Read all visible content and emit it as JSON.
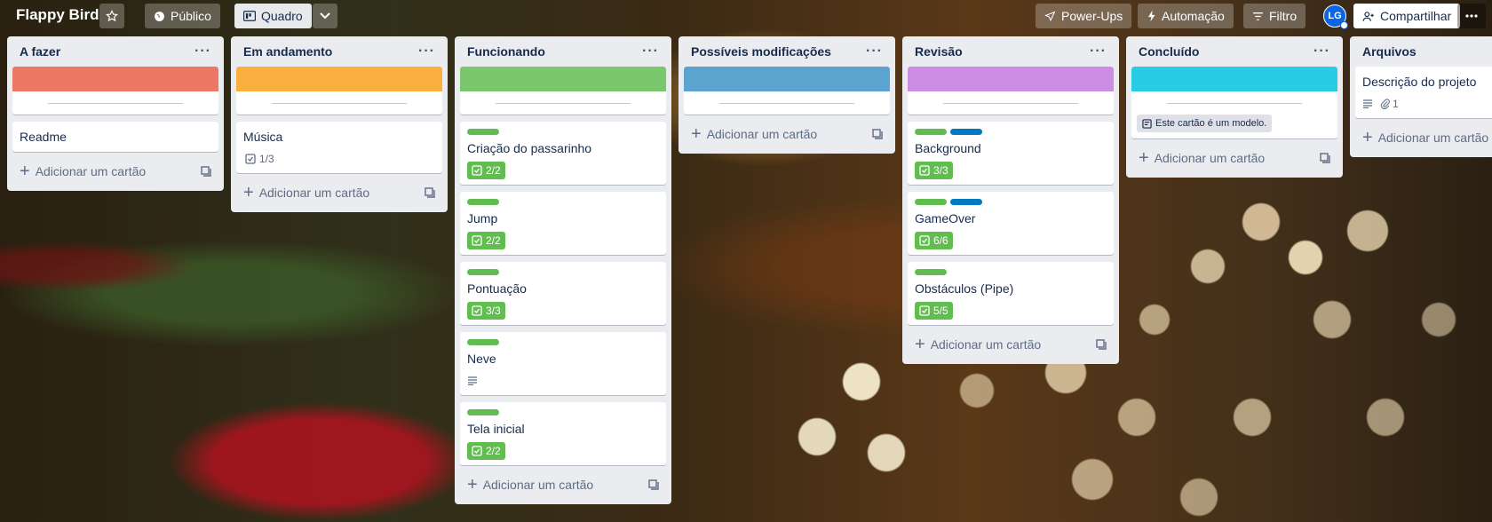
{
  "board": {
    "title": "Flappy Bird",
    "visibility": "Público",
    "view": "Quadro",
    "power_ups": "Power-Ups",
    "automation": "Automação",
    "filter": "Filtro",
    "avatar_initials": "LG",
    "share": "Compartilhar"
  },
  "common": {
    "add_card": "Adicionar um cartão"
  },
  "lists": [
    {
      "title": "A fazer",
      "cover_color": "#eb7764",
      "cards": [
        {
          "title": "Readme"
        }
      ]
    },
    {
      "title": "Em andamento",
      "cover_color": "#faaf3f",
      "cards": [
        {
          "title": "Música",
          "checklist": "1/3"
        }
      ]
    },
    {
      "title": "Funcionando",
      "cover_color": "#7bc86c",
      "cards": [
        {
          "title": "Criação do passarinho",
          "checklist": "2/2"
        },
        {
          "title": "Jump",
          "checklist": "2/2"
        },
        {
          "title": "Pontuação",
          "checklist": "3/3"
        },
        {
          "title": "Neve",
          "has_description": true
        },
        {
          "title": "Tela inicial",
          "checklist": "2/2"
        }
      ]
    },
    {
      "title": "Possíveis modificações",
      "cover_color": "#5ba4cf",
      "cards": []
    },
    {
      "title": "Revisão",
      "cover_color": "#cd8de5",
      "cards": [
        {
          "title": "Background",
          "checklist": "3/3"
        },
        {
          "title": "GameOver",
          "checklist": "6/6"
        },
        {
          "title": "Obstáculos (Pipe)",
          "checklist": "5/5"
        }
      ]
    },
    {
      "title": "Concluído",
      "cover_color": "#29cce5",
      "template_badge": "Este cartão é um modelo."
    },
    {
      "title": "Arquivos",
      "cards": [
        {
          "title": "Descrição do projeto",
          "attachments": "1"
        }
      ]
    }
  ],
  "colors": {
    "label_green": "#61bd4f",
    "label_blue": "#0079bf",
    "list_bg": "#ebecf0"
  }
}
